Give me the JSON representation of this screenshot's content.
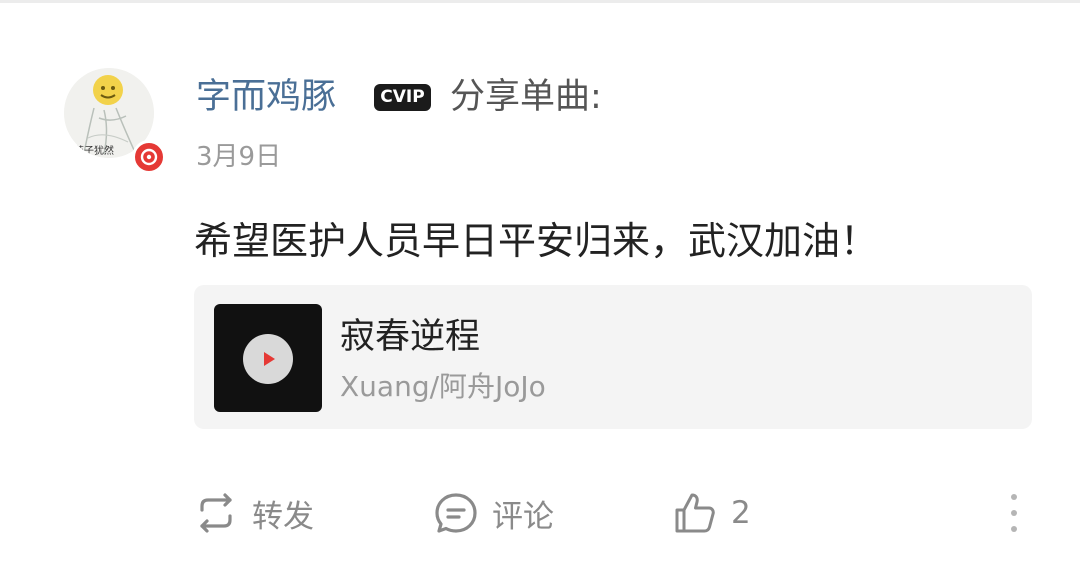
{
  "post": {
    "author": {
      "name": "字而鸡豚",
      "vip_badge": "CVIP",
      "avatar_caption": "芍子犹然"
    },
    "action_text": "分享单曲:",
    "date": "3月9日",
    "content": "希望医护人员早日平安归来，武汉加油！",
    "song": {
      "title": "寂春逆程",
      "artist": "Xuang/阿舟JoJo"
    },
    "actions": {
      "repost_label": "转发",
      "comment_label": "评论",
      "like_count": "2"
    }
  },
  "colors": {
    "username": "#4a6f96",
    "badge_red": "#e53935",
    "card_bg": "#f4f4f4",
    "muted_text": "#9a9a9a"
  },
  "icons": [
    "music-badge-icon",
    "play-icon",
    "repost-icon",
    "comment-icon",
    "like-icon",
    "more-icon"
  ]
}
